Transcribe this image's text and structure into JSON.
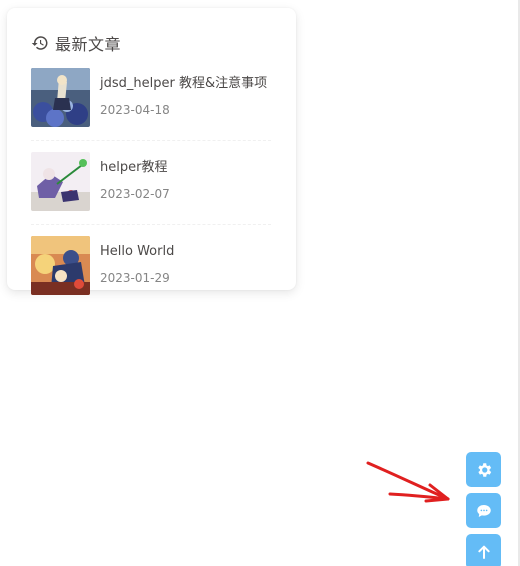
{
  "widget": {
    "title": "最新文章",
    "header_icon": "history-icon"
  },
  "posts": [
    {
      "title": "jdsd_helper 教程&注意事项",
      "date": "2023-04-18",
      "thumb_icon": "post-thumbnail-image"
    },
    {
      "title": "helper教程",
      "date": "2023-02-07",
      "thumb_icon": "post-thumbnail-image"
    },
    {
      "title": "Hello World",
      "date": "2023-01-29",
      "thumb_icon": "post-thumbnail-image"
    }
  ],
  "rightside": {
    "buttons": [
      {
        "icon": "gear-icon"
      },
      {
        "icon": "comment-icon"
      },
      {
        "icon": "arrow-up-icon"
      }
    ],
    "accent_color": "#49b1f5"
  },
  "annotation": {
    "arrow_color": "#e02020"
  }
}
